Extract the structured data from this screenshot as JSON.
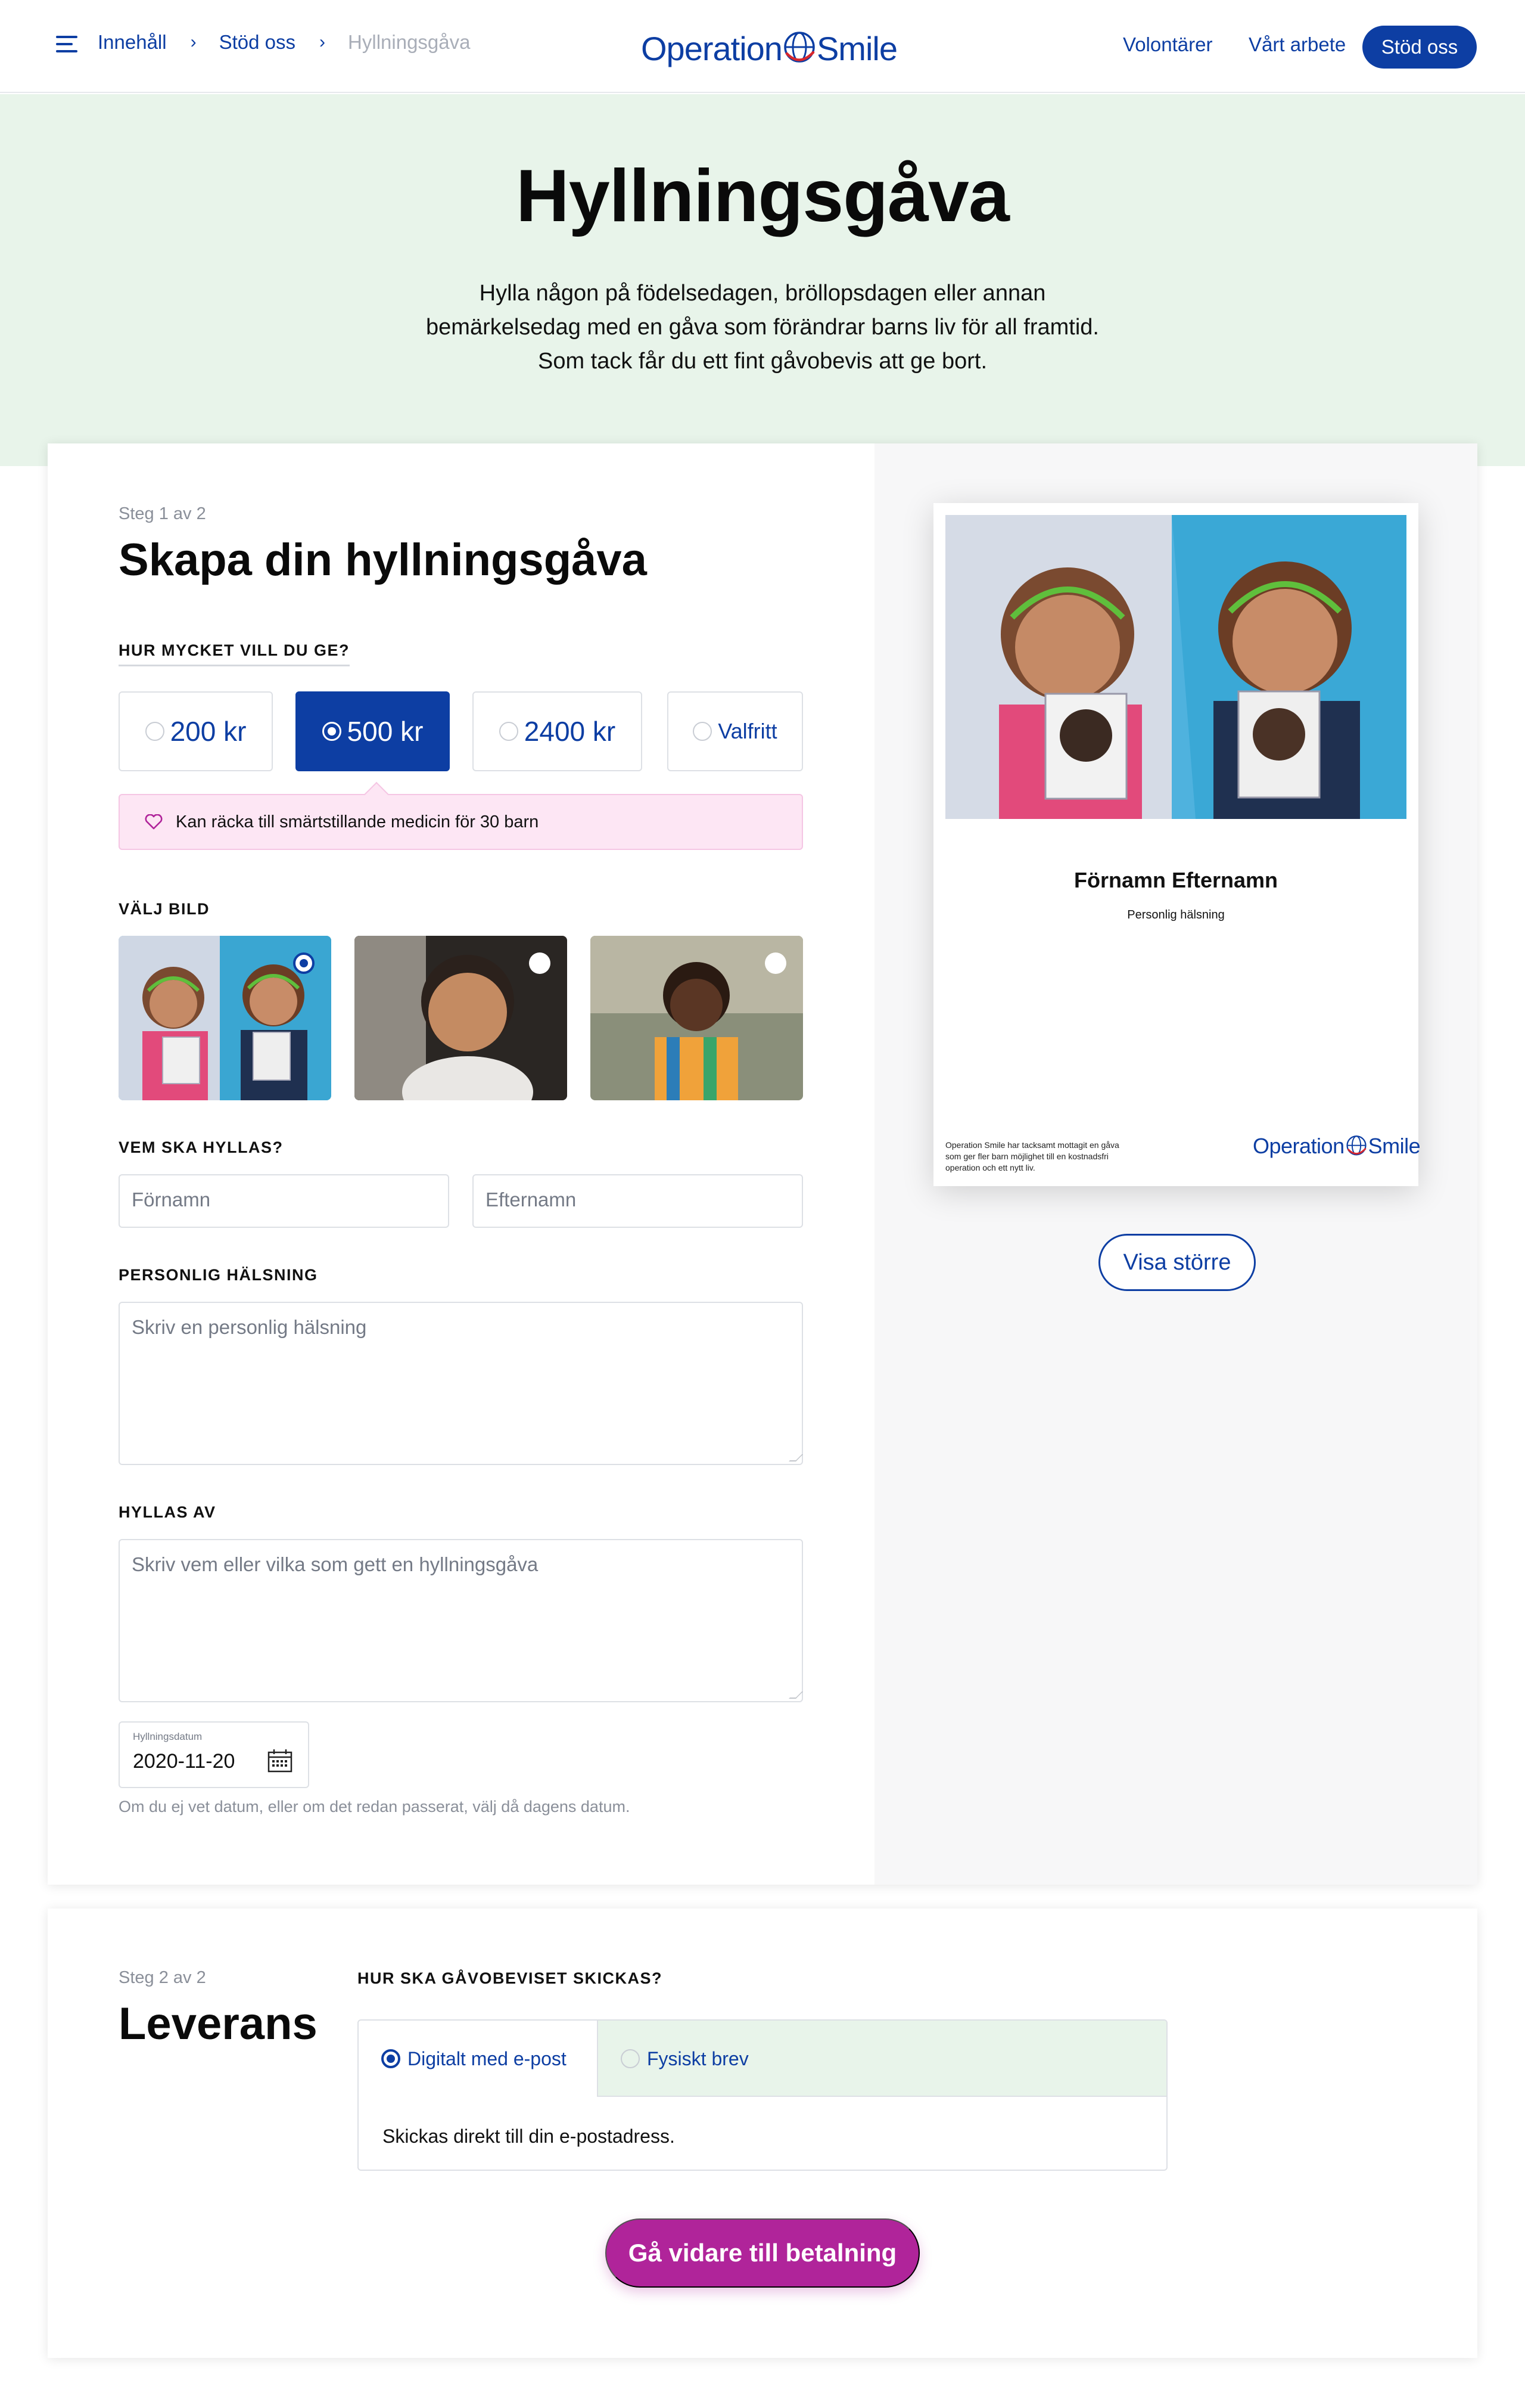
{
  "header": {
    "breadcrumb": [
      "Innehåll",
      "Stöd oss",
      "Hyllningsgåva"
    ],
    "logo": {
      "left": "Operation",
      "right": "Smile"
    },
    "nav": {
      "volunteers": "Volontärer",
      "our_work": "Vårt arbete",
      "support": "Stöd oss"
    }
  },
  "hero": {
    "title": "Hyllningsgåva",
    "intro": "Hylla någon på födelsedagen, bröllopsdagen eller annan bemärkelsedag med en gåva som förändrar barns liv för all framtid. Som tack får du ett fint gåvobevis att ge bort."
  },
  "step1": {
    "step": "Steg 1 av 2",
    "title": "Skapa din hyllningsgåva",
    "amount_label": "HUR MYCKET VILL DU GE?",
    "amounts": [
      "200 kr",
      "500 kr",
      "2400 kr",
      "Valfritt"
    ],
    "selected_amount": "500 kr",
    "info": "Kan räcka till smärtstillande medicin för 30 barn",
    "image_label": "VÄLJ BILD",
    "images": [
      "two-girls-holding-photos",
      "smiling-boy",
      "smiling-girl"
    ],
    "selected_image": "two-girls-holding-photos",
    "honoree_label": "VEM SKA HYLLAS?",
    "firstname_placeholder": "Förnamn",
    "lastname_placeholder": "Efternamn",
    "greeting_label": "PERSONLIG HÄLSNING",
    "greeting_placeholder": "Skriv en personlig hälsning",
    "from_label": "HYLLAS AV",
    "from_placeholder": "Skriv vem eller vilka som gett en hyllningsgåva",
    "date_label": "Hyllningsdatum",
    "date_value": "2020-11-20",
    "date_hint": "Om du ej vet datum, eller om det redan passerat, välj då dagens datum."
  },
  "preview": {
    "name": "Förnamn Efternamn",
    "greeting": "Personlig hälsning",
    "footer_text": "Operation Smile har tacksamt mottagit en gåva som ger fler barn möjlighet till en kostnadsfri operation och ett nytt liv.",
    "logo": {
      "left": "Operation",
      "right": "Smile"
    },
    "show_larger": "Visa större"
  },
  "step2": {
    "step": "Steg 2 av 2",
    "title": "Leverans",
    "delivery_label": "HUR SKA GÅVOBEVISET SKICKAS?",
    "options": [
      "Digitalt med e-post",
      "Fysiskt brev"
    ],
    "selected_option": "Digitalt med e-post",
    "description": "Skickas direkt till din e-postadress.",
    "continue": "Gå vidare till betalning"
  },
  "colors": {
    "brand_blue": "#0d3ea3",
    "hero_bg": "#e8f4ea",
    "pay_button": "#b0249a",
    "info_bg": "#fde6f4"
  }
}
